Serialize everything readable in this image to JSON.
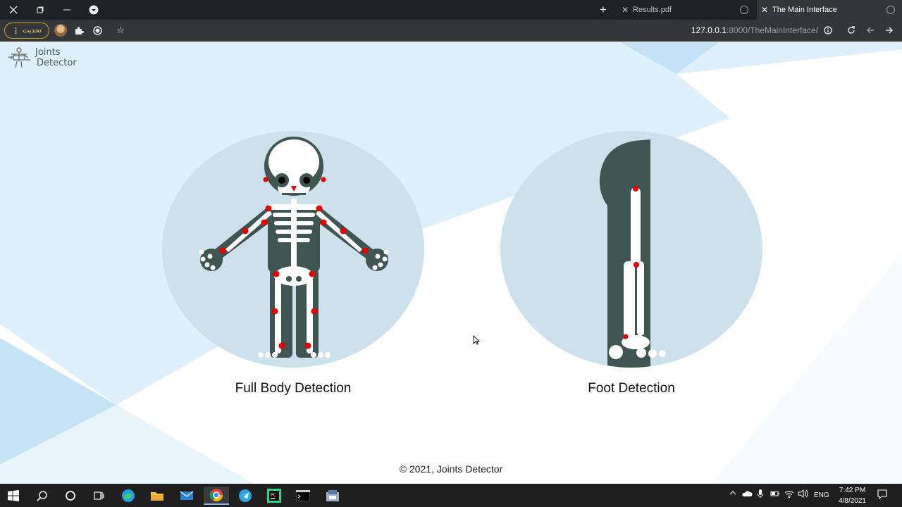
{
  "browser": {
    "tabs": [
      {
        "title": "Results.pdf",
        "active": false
      },
      {
        "title": "The Main Interface",
        "active": true
      }
    ],
    "update_label": "تحديث",
    "url_host": "127.0.0.1",
    "url_rest": ":8000/TheMainInterface/"
  },
  "page": {
    "logo_line1": "Joints",
    "logo_line2": "Detector",
    "cards": [
      {
        "label": "Full Body Detection"
      },
      {
        "label": "Foot Detection"
      }
    ],
    "footer": "© 2021, Joints Detector"
  },
  "taskbar": {
    "language": "ENG",
    "time": "7:42 PM",
    "date": "4/8/2021"
  },
  "colors": {
    "circle_bg": "#cce1ec",
    "bone": "#ffffff",
    "body": "#3f5552",
    "joint": "#e60000",
    "page_accent": "#ddf0fb"
  }
}
